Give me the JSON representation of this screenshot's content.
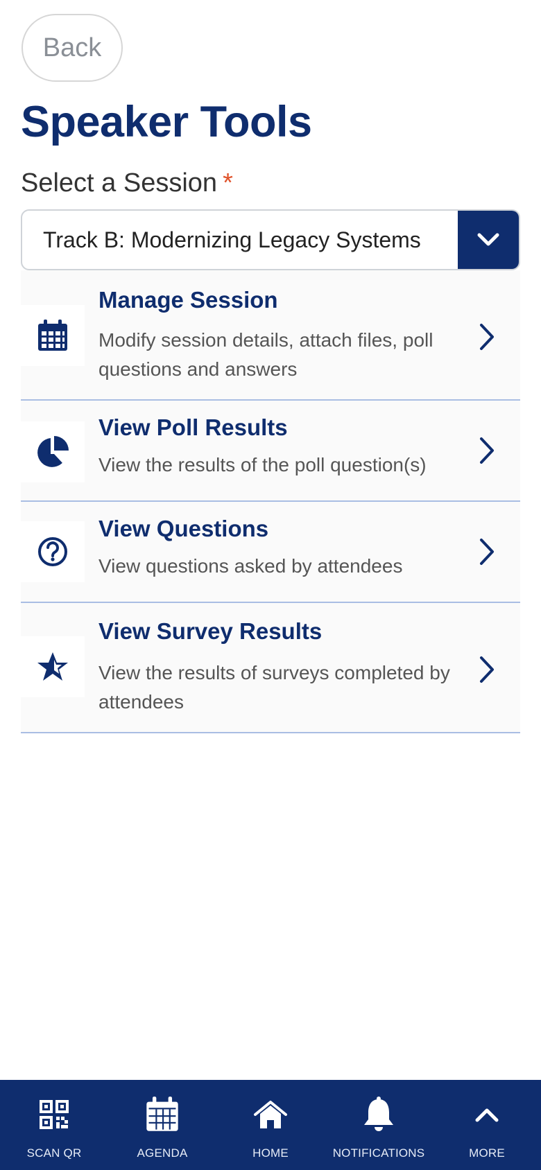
{
  "header": {
    "back_label": "Back",
    "title": "Speaker Tools"
  },
  "session_select": {
    "label": "Select a Session",
    "required_mark": "*",
    "selected_value": "Track B: Modernizing Legacy Systems"
  },
  "menu": [
    {
      "icon": "calendar-icon",
      "title": "Manage Session",
      "description": "Modify session details, attach files, poll questions and answers"
    },
    {
      "icon": "pie-chart-icon",
      "title": "View Poll Results",
      "description": "View the results of the poll question(s)"
    },
    {
      "icon": "question-circle-icon",
      "title": "View Questions",
      "description": "View questions asked by attendees"
    },
    {
      "icon": "star-icon",
      "title": "View Survey Results",
      "description": "View the results of surveys completed by attendees"
    }
  ],
  "bottom_nav": [
    {
      "icon": "qr-code-icon",
      "label": "SCAN QR"
    },
    {
      "icon": "calendar-icon",
      "label": "AGENDA"
    },
    {
      "icon": "home-icon",
      "label": "HOME"
    },
    {
      "icon": "bell-icon",
      "label": "NOTIFICATIONS"
    },
    {
      "icon": "chevron-up-icon",
      "label": "MORE"
    }
  ],
  "colors": {
    "brand_navy": "#0f2d6e",
    "required": "#e0532b",
    "divider": "#a9bde3"
  }
}
